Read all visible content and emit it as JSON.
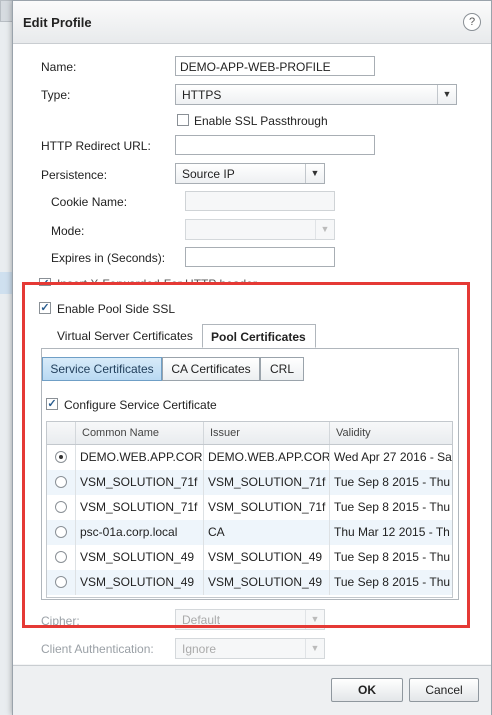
{
  "dialog": {
    "title": "Edit Profile",
    "help_glyph": "?"
  },
  "form": {
    "name_label": "Name:",
    "name_value": "DEMO-APP-WEB-PROFILE",
    "type_label": "Type:",
    "type_value": "HTTPS",
    "ssl_passthrough_label": "Enable SSL Passthrough",
    "redirect_label": "HTTP Redirect URL:",
    "redirect_value": "",
    "persistence_label": "Persistence:",
    "persistence_value": "Source IP",
    "cookie_label": "Cookie Name:",
    "mode_label": "Mode:",
    "expires_label": "Expires in (Seconds):",
    "xff_label": "Insert X-Forwarded-For HTTP header",
    "pool_ssl_label": "Enable Pool Side SSL",
    "cipher_label": "Cipher:",
    "cipher_value": "Default",
    "client_auth_label": "Client Authentication:",
    "client_auth_value": "Ignore"
  },
  "cert_tabs": [
    "Virtual Server Certificates",
    "Pool Certificates"
  ],
  "cert_subtabs": [
    "Service Certificates",
    "CA Certificates",
    "CRL"
  ],
  "configure_label": "Configure Service Certificate",
  "table": {
    "columns": [
      "Common Name",
      "Issuer",
      "Validity"
    ],
    "rows": [
      {
        "common_name": "DEMO.WEB.APP.COR",
        "issuer": "DEMO.WEB.APP.COR",
        "validity": "Wed Apr 27 2016 - Sa",
        "selected": true
      },
      {
        "common_name": "VSM_SOLUTION_71f",
        "issuer": "VSM_SOLUTION_71f",
        "validity": "Tue Sep 8 2015 - Thu",
        "selected": false
      },
      {
        "common_name": "VSM_SOLUTION_71f",
        "issuer": "VSM_SOLUTION_71f",
        "validity": "Tue Sep 8 2015 - Thu",
        "selected": false
      },
      {
        "common_name": "psc-01a.corp.local",
        "issuer": "CA",
        "validity": "Thu Mar 12 2015 - Th",
        "selected": false
      },
      {
        "common_name": "VSM_SOLUTION_49",
        "issuer": "VSM_SOLUTION_49",
        "validity": "Tue Sep 8 2015 - Thu",
        "selected": false
      },
      {
        "common_name": "VSM_SOLUTION_49",
        "issuer": "VSM_SOLUTION_49",
        "validity": "Tue Sep 8 2015 - Thu",
        "selected": false
      }
    ]
  },
  "buttons": {
    "ok": "OK",
    "cancel": "Cancel"
  },
  "colors": {
    "highlight": "#e53935",
    "active_tab": "#b9d9f2"
  }
}
